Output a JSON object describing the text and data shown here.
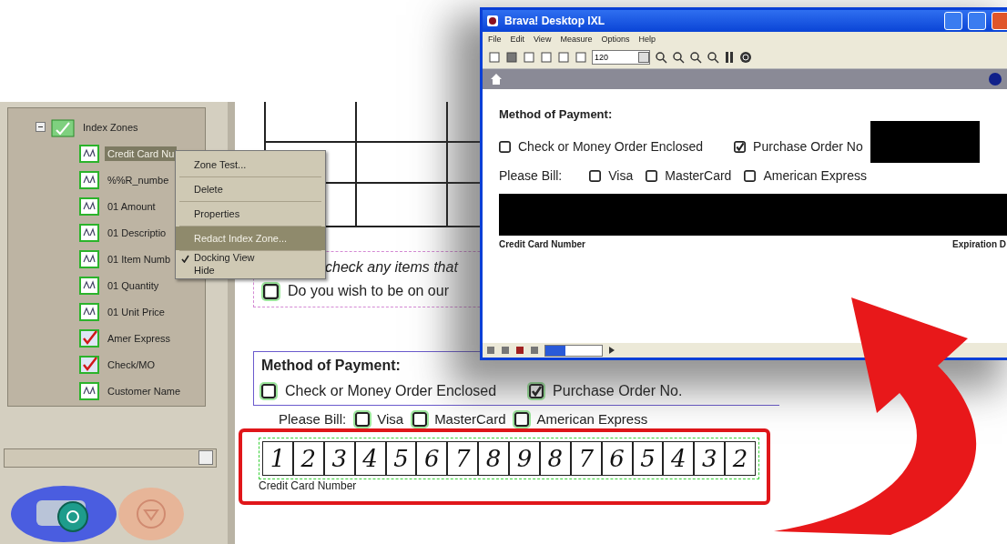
{
  "left_app": {
    "tree": {
      "label": "Index Zones",
      "expanded": true,
      "children": [
        {
          "label": "Credit Card Nu",
          "kind": "text",
          "selected": true
        },
        {
          "label": "%%R_numbe",
          "kind": "text",
          "selected": false
        },
        {
          "label": "01 Amount",
          "kind": "text",
          "selected": false
        },
        {
          "label": "01 Descriptio",
          "kind": "text",
          "selected": false
        },
        {
          "label": "01 Item Numb",
          "kind": "text",
          "selected": false
        },
        {
          "label": "01 Quantity",
          "kind": "text",
          "selected": false
        },
        {
          "label": "01 Unit Price",
          "kind": "text",
          "selected": false
        },
        {
          "label": "Amer Express",
          "kind": "check",
          "selected": false
        },
        {
          "label": "Check/MO",
          "kind": "check",
          "selected": false
        },
        {
          "label": "Customer Name",
          "kind": "text",
          "selected": false
        }
      ]
    },
    "context_menu": [
      {
        "label": "Zone Test...",
        "selected": false,
        "checked": false
      },
      {
        "label": "Delete",
        "selected": false,
        "checked": false
      },
      {
        "label": "Properties",
        "selected": false,
        "checked": false
      },
      {
        "label": "Redact Index Zone...",
        "selected": true,
        "checked": false
      },
      {
        "label": "Docking View",
        "selected": false,
        "checked": true
      },
      {
        "label": "Hide",
        "selected": false,
        "checked": false
      }
    ],
    "form": {
      "check_prompt": "check any items that",
      "mailing_question": {
        "label": "Do you wish to be on our",
        "checked": false
      },
      "payment_title": "Method of Payment:",
      "payment_options": [
        {
          "label": "Check or Money Order Enclosed",
          "checked": false
        },
        {
          "label": "Purchase Order No.",
          "checked": true
        }
      ],
      "bill_label": "Please Bill:",
      "cards": [
        {
          "label": "Visa",
          "checked": false
        },
        {
          "label": "MasterCard",
          "checked": false
        },
        {
          "label": "American Express",
          "checked": false
        }
      ],
      "card_digits": [
        "1",
        "2",
        "3",
        "4",
        "5",
        "6",
        "7",
        "8",
        "9",
        "8",
        "7",
        "6",
        "5",
        "4",
        "3",
        "2"
      ],
      "card_caption": "Credit Card Number"
    }
  },
  "viewer": {
    "title": "Brava! Desktop IXL",
    "menu": [
      "File",
      "Edit",
      "View",
      "Measure",
      "Options",
      "Help"
    ],
    "zoom": "120",
    "form": {
      "payment_title": "Method of Payment:",
      "payment_options": [
        {
          "label": "Check or Money Order Enclosed",
          "checked": false
        },
        {
          "label": "Purchase Order No",
          "checked": true
        }
      ],
      "bill_label": "Please Bill:",
      "cards": [
        {
          "label": "Visa",
          "checked": false
        },
        {
          "label": "MasterCard",
          "checked": false
        },
        {
          "label": "American Express",
          "checked": false
        }
      ],
      "card_caption": "Credit Card Number",
      "expiration_caption": "Expiration D"
    }
  }
}
